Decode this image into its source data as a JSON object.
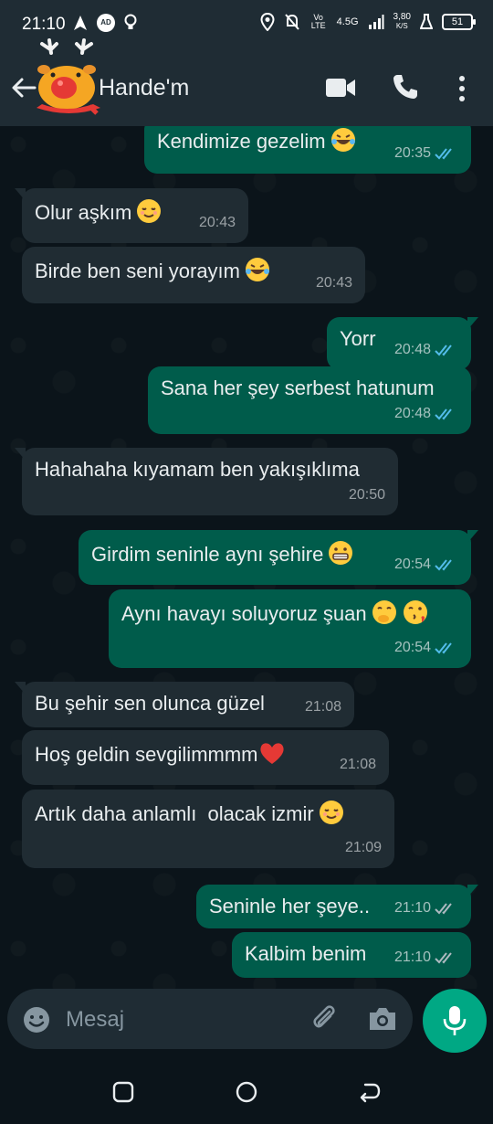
{
  "status_bar": {
    "time": "21:10",
    "network_speed_value": "3,80",
    "network_speed_unit": "K/S",
    "network_type": "4.5G",
    "volte_label": "Vo LTE",
    "battery": "51",
    "ad_badge": "AD"
  },
  "header": {
    "contact_name": "Hande'm",
    "icons": [
      "back-arrow-icon",
      "video-call-icon",
      "phone-icon",
      "more-vert-icon"
    ]
  },
  "messages": [
    {
      "dir": "out",
      "text": "Kendimize gezelim",
      "emoji": [
        "laugh"
      ],
      "time": "20:35",
      "read": true
    },
    {
      "dir": "in",
      "text": "Olur aşkım",
      "emoji": [
        "relieved"
      ],
      "time": "20:43"
    },
    {
      "dir": "in",
      "text": "Birde ben seni yorayım",
      "emoji": [
        "laugh"
      ],
      "time": "20:43"
    },
    {
      "dir": "out",
      "text": "Yorr",
      "emoji": [],
      "time": "20:48",
      "read": true
    },
    {
      "dir": "out",
      "text": "Sana her şey serbest hatunum",
      "emoji": [],
      "time": "20:48",
      "read": true
    },
    {
      "dir": "in",
      "text": "Hahahaha kıyamam ben yakışıklıma",
      "emoji": [],
      "time": "20:50"
    },
    {
      "dir": "out",
      "text": "Girdim seninle aynı şehire",
      "emoji": [
        "grimace"
      ],
      "time": "20:54",
      "read": true
    },
    {
      "dir": "out",
      "text": "Aynı havayı soluyoruz şuan",
      "emoji": [
        "giggle",
        "kiss"
      ],
      "time": "20:54",
      "read": true
    },
    {
      "dir": "in",
      "text": "Bu şehir sen olunca güzel",
      "emoji": [],
      "time": "21:08"
    },
    {
      "dir": "in",
      "text": "Hoş geldin sevgilimmmm",
      "emoji": [
        "heart"
      ],
      "time": "21:08"
    },
    {
      "dir": "in",
      "text": "Artık daha anlamlı  olacak izmir",
      "emoji": [
        "relieved"
      ],
      "time": "21:09"
    },
    {
      "dir": "out",
      "text": "Seninle her şeye..",
      "emoji": [],
      "time": "21:10",
      "read": false
    },
    {
      "dir": "out",
      "text": "Kalbim benim",
      "emoji": [],
      "time": "21:10",
      "read": false
    }
  ],
  "composer": {
    "placeholder": "Mesaj",
    "icons": [
      "emoji-icon",
      "attach-icon",
      "camera-icon",
      "mic-icon"
    ]
  },
  "colors": {
    "outgoing_bubble": "#005c4b",
    "incoming_bubble": "#202c33",
    "read_ticks": "#53bdeb",
    "mic_button": "#00a884"
  }
}
